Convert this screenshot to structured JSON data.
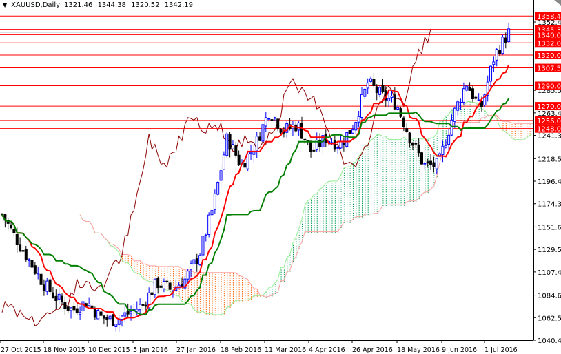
{
  "header": {
    "symbol": "XAUUSD,Daily",
    "open": "1321.46",
    "high": "1344.38",
    "low": "1320.52",
    "close": "1342.19"
  },
  "colors": {
    "up": "#0000ff",
    "down": "#000000",
    "tenkan": "#ff0000",
    "kijun": "#008000",
    "chikou": "#8b0000",
    "level": "#ff0000",
    "label_bg": "#ff0000"
  },
  "chart_data": {
    "type": "candlestick",
    "title": "XAUUSD,Daily",
    "ylim": [
      1040.45,
      1362
    ],
    "y_ticks": [
      "1352.45",
      "1285.50",
      "1263.40",
      "1241.30",
      "1218.55",
      "1196.45",
      "1174.35",
      "1151.60",
      "1129.50",
      "1107.40",
      "1084.65",
      "1062.55",
      "1040.45"
    ],
    "x_ticks": [
      "27 Oct 2015",
      "18 Nov 2015",
      "10 Dec 2015",
      "5 Jan 2016",
      "27 Jan 2016",
      "18 Feb 2016",
      "11 Mar 2016",
      "4 Apr 2016",
      "26 Apr 2016",
      "18 May 2016",
      "9 Jun 2016",
      "1 Jul 2016"
    ],
    "levels": [
      "1358.40",
      "1345.30",
      "1340.00",
      "1332.00",
      "1320.00",
      "1307.50",
      "1290.00",
      "1270.00",
      "1256.00",
      "1248.00"
    ],
    "close_path": [
      1164,
      1140,
      1117,
      1095,
      1080,
      1070,
      1078,
      1063,
      1060,
      1067,
      1075,
      1097,
      1090,
      1100,
      1124,
      1171,
      1239,
      1212,
      1232,
      1266,
      1246,
      1252,
      1225,
      1239,
      1232,
      1252,
      1293,
      1280,
      1273,
      1239,
      1212,
      1212,
      1259,
      1293,
      1266,
      1320,
      1342
    ]
  }
}
